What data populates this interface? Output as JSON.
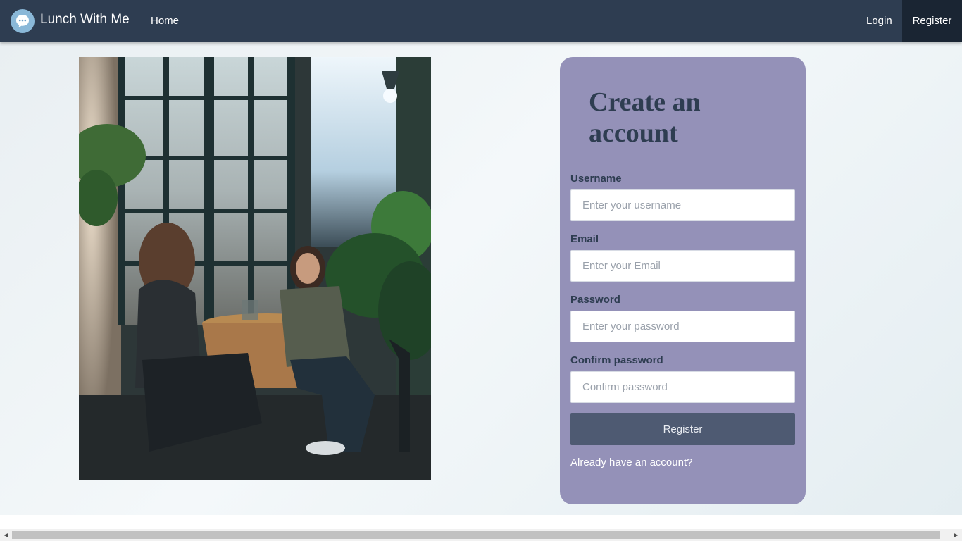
{
  "navbar": {
    "brand_name": "Lunch With Me",
    "brand_icon": "chat-bubble-icon",
    "home_label": "Home",
    "login_label": "Login",
    "register_label": "Register"
  },
  "photo": {
    "alt": "Two women talking at a café table"
  },
  "form": {
    "title": "Create an account",
    "username": {
      "label": "Username",
      "placeholder": "Enter your username",
      "value": ""
    },
    "email": {
      "label": "Email",
      "placeholder": "Enter your Email",
      "value": ""
    },
    "password": {
      "label": "Password",
      "placeholder": "Enter your password",
      "value": ""
    },
    "confirm": {
      "label": "Confirm password",
      "placeholder": "Confirm password",
      "value": ""
    },
    "submit_label": "Register",
    "login_link": "Already have an account?"
  },
  "colors": {
    "navbar": "#2e3d51",
    "card": "#9491b8",
    "button": "#4e5a72"
  }
}
